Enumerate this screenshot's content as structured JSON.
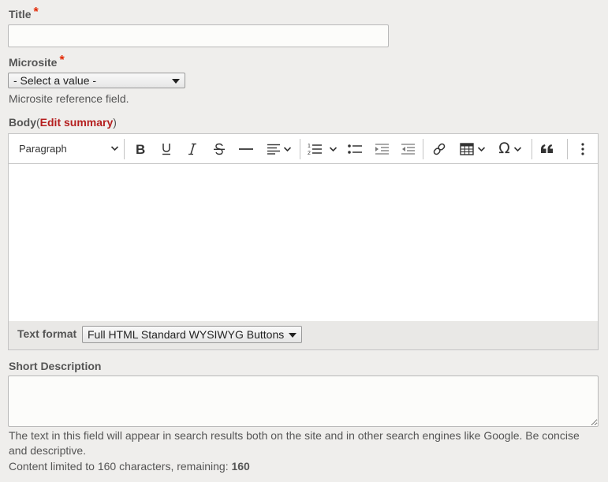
{
  "title_field": {
    "label": "Title",
    "value": ""
  },
  "microsite": {
    "label": "Microsite",
    "selected": "- Select a value -",
    "help": "Microsite reference field."
  },
  "body": {
    "label": "Body",
    "open_paren": "(",
    "edit_summary": "Edit summary",
    "close_paren": ")",
    "paragraph_label": "Paragraph",
    "text_format_label": "Text format",
    "text_format_value": "Full HTML Standard WYSIWYG Buttons"
  },
  "toolbar_icons": [
    "chevron-down-icon",
    "bold-icon",
    "underline-icon",
    "italic-icon",
    "strikethrough-icon",
    "horizontal-line-icon",
    "align-icon",
    "numbered-list-icon",
    "bulleted-list-icon",
    "outdent-icon",
    "indent-icon",
    "link-icon",
    "table-icon",
    "special-characters-icon",
    "blockquote-icon",
    "more-options-icon"
  ],
  "short_description": {
    "label": "Short Description",
    "value": "",
    "help_line1": "The text in this field will appear in search results both on the site and in other search engines like Google. Be concise",
    "help_line2": "and descriptive.",
    "limit_text": "Content limited to 160 characters, remaining: ",
    "remaining": "160"
  },
  "colors": {
    "required": "#e32700",
    "link": "#b51f1f",
    "page_bg": "#efeeec"
  }
}
